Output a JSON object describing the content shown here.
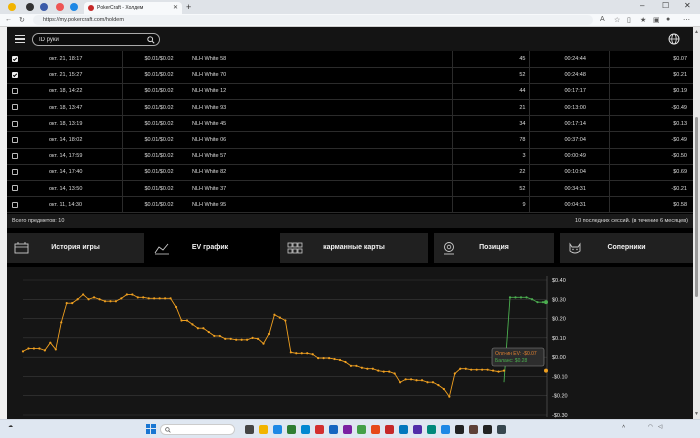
{
  "browser": {
    "active_tab_title": "PokerCraft - Холдем",
    "url": "https://my.pokercraft.com/holdem"
  },
  "header": {
    "search_placeholder": "ID руки"
  },
  "sessions": {
    "rows": [
      {
        "checked": true,
        "date": "окт. 21, 18:17",
        "stakes": "$0.01/$0.02",
        "game": "NLH White 58",
        "hands": "45",
        "duration": "00:24:44",
        "result": "$0.07"
      },
      {
        "checked": true,
        "date": "окт. 21, 15:27",
        "stakes": "$0.01/$0.02",
        "game": "NLH White 70",
        "hands": "52",
        "duration": "00:24:48",
        "result": "$0.21"
      },
      {
        "checked": false,
        "date": "окт. 18, 14:22",
        "stakes": "$0.01/$0.02",
        "game": "NLH White 12",
        "hands": "44",
        "duration": "00:17:17",
        "result": "$0.19"
      },
      {
        "checked": false,
        "date": "окт. 18, 13:47",
        "stakes": "$0.01/$0.02",
        "game": "NLH White 93",
        "hands": "21",
        "duration": "00:13:00",
        "result": "-$0.49"
      },
      {
        "checked": false,
        "date": "окт. 18, 13:19",
        "stakes": "$0.01/$0.02",
        "game": "NLH White 45",
        "hands": "34",
        "duration": "00:17:14",
        "result": "$0.13"
      },
      {
        "checked": false,
        "date": "окт. 14, 18:02",
        "stakes": "$0.01/$0.02",
        "game": "NLH White 06",
        "hands": "78",
        "duration": "00:37:04",
        "result": "-$0.49"
      },
      {
        "checked": false,
        "date": "окт. 14, 17:59",
        "stakes": "$0.01/$0.02",
        "game": "NLH White 57",
        "hands": "3",
        "duration": "00:00:49",
        "result": "-$0.50"
      },
      {
        "checked": false,
        "date": "окт. 14, 17:40",
        "stakes": "$0.01/$0.02",
        "game": "NLH White 82",
        "hands": "22",
        "duration": "00:10:04",
        "result": "$0.69"
      },
      {
        "checked": false,
        "date": "окт. 14, 13:50",
        "stakes": "$0.01/$0.02",
        "game": "NLH White 37",
        "hands": "52",
        "duration": "00:34:31",
        "result": "-$0.21"
      },
      {
        "checked": false,
        "date": "окт. 11, 14:30",
        "stakes": "$0.01/$0.02",
        "game": "NLH White 95",
        "hands": "9",
        "duration": "00:04:31",
        "result": "$0.58"
      }
    ],
    "total_label": "Всего предметов: 10",
    "period_label": "10 последних сессий. (в течение 6 месяцев)"
  },
  "nav_tabs": {
    "history": "История игры",
    "ev": "EV график",
    "pocket": "карманные карты",
    "position": "Позиция",
    "opponents": "Соперники"
  },
  "tooltip": {
    "ev_line": "Олл-ин EV: -$0.07",
    "balance_line": "Баланс: $0.28"
  },
  "chart_data": {
    "type": "line",
    "y_ticks": [
      "$0.40",
      "$0.30",
      "$0.20",
      "$0.10",
      "$0.00",
      "-$0.10",
      "-$0.20",
      "-$0.30"
    ],
    "ylim": [
      -0.3,
      0.4
    ],
    "grid": true,
    "series": [
      {
        "color": "#f0a020",
        "values": [
          0.03,
          0.045,
          0.045,
          0.045,
          0.035,
          0.075,
          0.04,
          0.18,
          0.28,
          0.28,
          0.3,
          0.325,
          0.3,
          0.31,
          0.3,
          0.29,
          0.29,
          0.29,
          0.305,
          0.325,
          0.325,
          0.31,
          0.31,
          0.305,
          0.305,
          0.305,
          0.305,
          0.305,
          0.26,
          0.19,
          0.19,
          0.17,
          0.15,
          0.15,
          0.13,
          0.11,
          0.11,
          0.095,
          0.095,
          0.09,
          0.09,
          0.09,
          0.1,
          0.095,
          0.07,
          0.12,
          0.22,
          0.205,
          0.19,
          0.025,
          0.02,
          0.02,
          0.02,
          0.015,
          -0.005,
          -0.005,
          -0.005,
          -0.01,
          -0.015,
          -0.025,
          -0.045,
          -0.045,
          -0.055,
          -0.06,
          -0.06,
          -0.07,
          -0.075,
          -0.075,
          -0.085,
          -0.13,
          -0.115,
          -0.115,
          -0.12,
          -0.12,
          -0.13,
          -0.13,
          -0.145,
          -0.165,
          -0.205,
          -0.085,
          -0.06,
          -0.06,
          -0.065,
          -0.065,
          -0.065,
          -0.065,
          -0.07,
          -0.075,
          -0.07
        ]
      },
      {
        "color": "#4caf50",
        "values": [
          0.31,
          0.31,
          0.31,
          0.31,
          0.3,
          0.285,
          0.285
        ]
      }
    ]
  }
}
